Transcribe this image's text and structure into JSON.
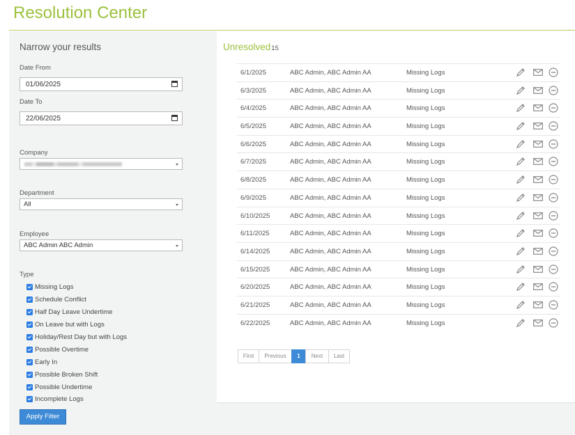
{
  "page": {
    "title": "Resolution Center"
  },
  "filters": {
    "heading": "Narrow your results",
    "date_from_label": "Date From",
    "date_from_value": "01/06/2025",
    "date_to_label": "Date To",
    "date_to_value": "22/06/2025",
    "company_label": "Company",
    "department_label": "Department",
    "department_value": "All",
    "employee_label": "Employee",
    "employee_value": "ABC Admin ABC Admin",
    "type_label": "Type",
    "types": [
      "Missing Logs",
      "Schedule Conflict",
      "Half Day Leave Undertime",
      "On Leave but with Logs",
      "Holiday/Rest Day but with Logs",
      "Possible Overtime",
      "Early In",
      "Possible Broken Shift",
      "Possible Undertime",
      "Incomplete Logs"
    ],
    "apply_label": "Apply Filter"
  },
  "results": {
    "heading": "Unresolved",
    "count": "15",
    "rows": [
      {
        "date": "6/1/2025",
        "employee": "ABC Admin, ABC Admin AA",
        "type": "Missing Logs"
      },
      {
        "date": "6/3/2025",
        "employee": "ABC Admin, ABC Admin AA",
        "type": "Missing Logs"
      },
      {
        "date": "6/4/2025",
        "employee": "ABC Admin, ABC Admin AA",
        "type": "Missing Logs"
      },
      {
        "date": "6/5/2025",
        "employee": "ABC Admin, ABC Admin AA",
        "type": "Missing Logs"
      },
      {
        "date": "6/6/2025",
        "employee": "ABC Admin, ABC Admin AA",
        "type": "Missing Logs"
      },
      {
        "date": "6/7/2025",
        "employee": "ABC Admin, ABC Admin AA",
        "type": "Missing Logs"
      },
      {
        "date": "6/8/2025",
        "employee": "ABC Admin, ABC Admin AA",
        "type": "Missing Logs"
      },
      {
        "date": "6/9/2025",
        "employee": "ABC Admin, ABC Admin AA",
        "type": "Missing Logs"
      },
      {
        "date": "6/10/2025",
        "employee": "ABC Admin, ABC Admin AA",
        "type": "Missing Logs"
      },
      {
        "date": "6/11/2025",
        "employee": "ABC Admin, ABC Admin AA",
        "type": "Missing Logs"
      },
      {
        "date": "6/14/2025",
        "employee": "ABC Admin, ABC Admin AA",
        "type": "Missing Logs"
      },
      {
        "date": "6/15/2025",
        "employee": "ABC Admin, ABC Admin AA",
        "type": "Missing Logs"
      },
      {
        "date": "6/20/2025",
        "employee": "ABC Admin, ABC Admin AA",
        "type": "Missing Logs"
      },
      {
        "date": "6/21/2025",
        "employee": "ABC Admin, ABC Admin AA",
        "type": "Missing Logs"
      },
      {
        "date": "6/22/2025",
        "employee": "ABC Admin, ABC Admin AA",
        "type": "Missing Logs"
      }
    ],
    "row_icons": [
      "pencil-icon",
      "envelope-icon",
      "minus-circle-icon"
    ]
  },
  "pagination": {
    "first": "First",
    "previous": "Previous",
    "current": "1",
    "next": "Next",
    "last": "Last"
  },
  "colors": {
    "accent": "#9bc13c",
    "button": "#3d8ad6",
    "checkbox": "#2a7be4",
    "panel": "#f2f3f3"
  }
}
